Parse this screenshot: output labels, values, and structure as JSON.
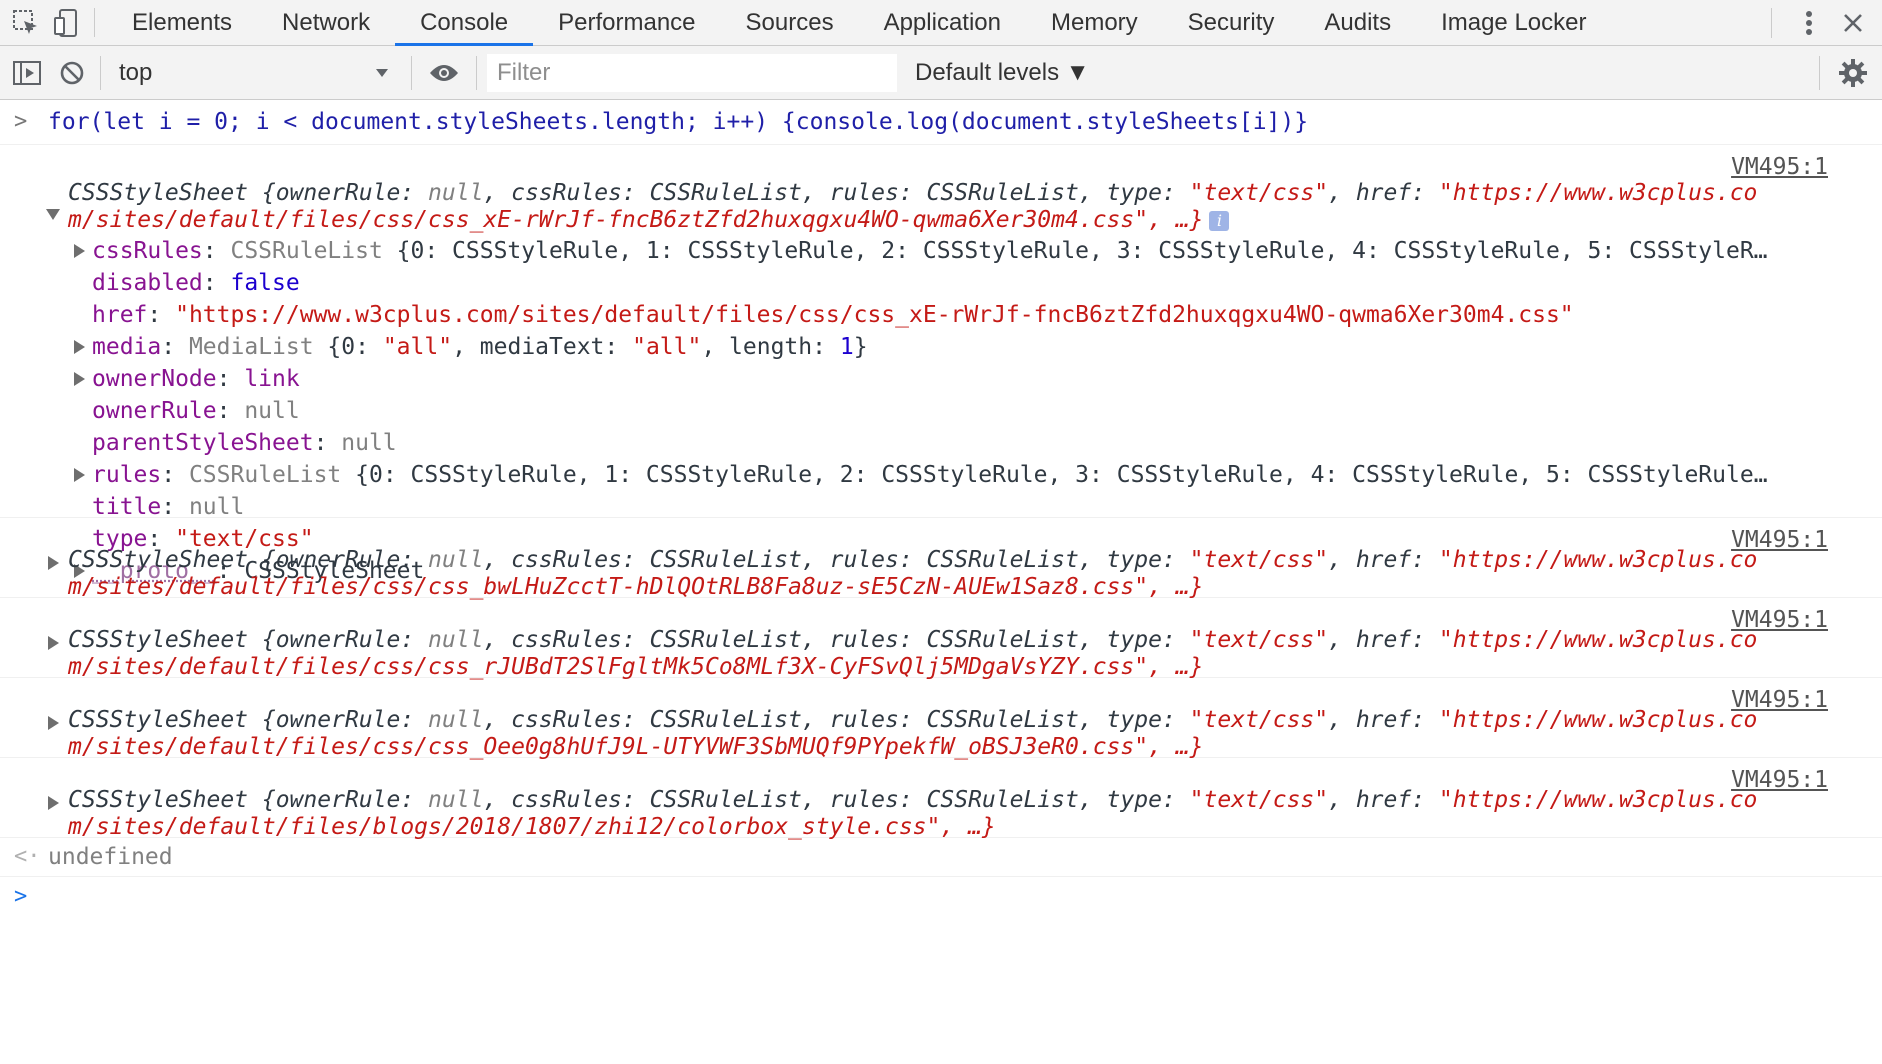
{
  "tabs": [
    "Elements",
    "Network",
    "Console",
    "Performance",
    "Sources",
    "Application",
    "Memory",
    "Security",
    "Audits",
    "Image Locker"
  ],
  "active_tab": "Console",
  "toolbar": {
    "context": "top",
    "filter_placeholder": "Filter",
    "levels": "Default levels ▼"
  },
  "command": "for(let i = 0; i < document.styleSheets.length; i++) {console.log(document.styleSheets[i])}",
  "source_link": "VM495:1",
  "expanded": {
    "summary1": "CSSStyleSheet {ownerRule: null, cssRules: CSSRuleList, rules: CSSRuleList, type: \"text/css\", href: \"https://www.w3cplus.co",
    "summary2": "m/sites/default/files/css/css_xE-rWrJf-fncB6ztZfd2huxqgxu4WO-qwma6Xer30m4.css\", …}",
    "props": {
      "cssRules": "cssRules: CSSRuleList {0: CSSStyleRule, 1: CSSStyleRule, 2: CSSStyleRule, 3: CSSStyleRule, 4: CSSStyleRule, 5: CSSStyleR…",
      "disabled": "disabled: false",
      "href": "href: \"https://www.w3cplus.com/sites/default/files/css/css_xE-rWrJf-fncB6ztZfd2huxqgxu4WO-qwma6Xer30m4.css\"",
      "media": "media: MediaList {0: \"all\", mediaText: \"all\", length: 1}",
      "ownerNode": "ownerNode: link",
      "ownerRule": "ownerRule: null",
      "parentStyleSheet": "parentStyleSheet: null",
      "rules": "rules: CSSRuleList {0: CSSStyleRule, 1: CSSStyleRule, 2: CSSStyleRule, 3: CSSStyleRule, 4: CSSStyleRule, 5: CSSStyleRule…",
      "title": "title: null",
      "type": "type: \"text/css\"",
      "proto": "__proto__: CSSStyleSheet"
    }
  },
  "collapsed": [
    "m/sites/default/files/css/css_bwLHuZcctT-hDlQOtRLB8Fa8uz-sE5CzN-AUEw1Saz8.css\", …}",
    "m/sites/default/files/css/css_rJUBdT2SlFgltMk5Co8MLf3X-CyFSvQlj5MDgaVsYZY.css\", …}",
    "m/sites/default/files/css/css_Oee0g8hUfJ9L-UTYVWF3SbMUQf9PYpekfW_oBSJ3eR0.css\", …}",
    "m/sites/default/files/blogs/2018/1807/zhi12/colorbox_style.css\", …}"
  ],
  "result": "undefined",
  "colors": {
    "accent": "#1a73e8",
    "property": "#881391",
    "string": "#c41a16",
    "number": "#1c00cf"
  }
}
